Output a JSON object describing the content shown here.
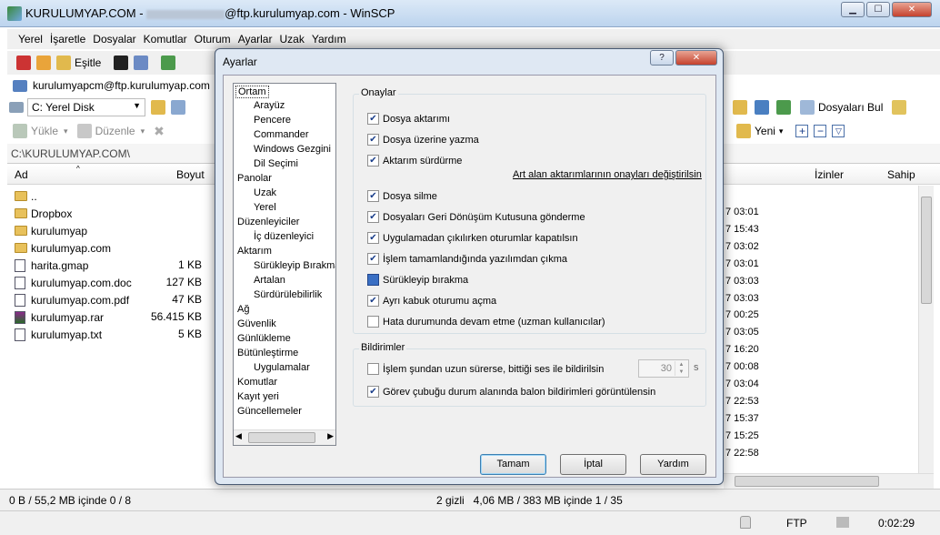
{
  "window": {
    "title_prefix": "KURULUMYAP.COM - ",
    "title_suffix": "@ftp.kurulumyap.com - WinSCP"
  },
  "menu": [
    "Yerel",
    "İşaretle",
    "Dosyalar",
    "Komutlar",
    "Oturum",
    "Ayarlar",
    "Uzak",
    "Yardım"
  ],
  "toolbar": {
    "sync_label": "Eşitle"
  },
  "session": {
    "label": "kurulumyapcm@ftp.kurulumyap.com"
  },
  "local": {
    "drive": "C: Yerel Disk",
    "upload": "Yükle",
    "edit": "Düzenle",
    "path": "C:\\KURULUMYAP.COM\\",
    "col_name": "Ad",
    "col_size": "Boyut",
    "files": [
      {
        "name": "..",
        "size": "",
        "icon": "folder-up"
      },
      {
        "name": "Dropbox",
        "size": "",
        "icon": "folder"
      },
      {
        "name": "kurulumyap",
        "size": "",
        "icon": "folder"
      },
      {
        "name": "kurulumyap.com",
        "size": "",
        "icon": "folder"
      },
      {
        "name": "harita.gmap",
        "size": "1 KB",
        "icon": "doc"
      },
      {
        "name": "kurulumyap.com.doc",
        "size": "127 KB",
        "icon": "doc"
      },
      {
        "name": "kurulumyap.com.pdf",
        "size": "47 KB",
        "icon": "doc"
      },
      {
        "name": "kurulumyap.rar",
        "size": "56.415 KB",
        "icon": "rar"
      },
      {
        "name": "kurulumyap.txt",
        "size": "5 KB",
        "icon": "doc"
      }
    ],
    "status": "0 B / 55,2 MB içinde 0 / 8"
  },
  "remote": {
    "find": "Dosyaları Bul",
    "new": "Yeni",
    "col_perm": "İzinler",
    "col_owner": "Sahip",
    "times": [
      "7 03:01",
      "7 15:43",
      "7 03:02",
      "7 03:01",
      "7 03:03",
      "7 03:03",
      "7 00:25",
      "7 03:05",
      "7 16:20",
      "7 00:08",
      "7 03:04",
      "7 22:53",
      "7 15:37",
      "7 15:25",
      "7 22:58"
    ],
    "status": "2 gizli   4,06 MB / 383 MB içinde 1 / 35"
  },
  "bottom": {
    "protocol": "FTP",
    "time": "0:02:29"
  },
  "dialog": {
    "title": "Ayarlar",
    "tree": [
      "Ortam",
      "Arayüz",
      "Pencere",
      "Commander",
      "Windows Gezgini",
      "Dil Seçimi",
      "Panolar",
      "Uzak",
      "Yerel",
      "Düzenleyiciler",
      "İç düzenleyici",
      "Aktarım",
      "Sürükleyip Bırakma",
      "Artalan",
      "Sürdürülebilirlik",
      "Ağ",
      "Güvenlik",
      "Günlükleme",
      "Bütünleştirme",
      "Uygulamalar",
      "Komutlar",
      "Kayıt yeri",
      "Güncellemeler"
    ],
    "confirm_group": "Onaylar",
    "confirms": [
      "Dosya aktarımı",
      "Dosya üzerine yazma",
      "Aktarım sürdürme",
      "Dosya silme",
      "Dosyaları Geri Dönüşüm Kutusuna gönderme",
      "Uygulamadan çıkılırken oturumlar kapatılsın",
      "İşlem tamamlandığında yazılımdan çıkma",
      "Sürükleyip bırakma",
      "Ayrı kabuk oturumu açma",
      "Hata durumunda devam etme (uzman kullanıcılar)"
    ],
    "bg_link": "Art alan aktarımlarının onayları değiştirilsin",
    "notify_group": "Bildirimler",
    "notify1": "İşlem şundan uzun sürerse, bittiği ses ile bildirilsin",
    "notify1_value": "30",
    "notify1_unit": "s",
    "notify2": "Görev çubuğu durum alanında balon bildirimleri görüntülensin",
    "ok": "Tamam",
    "cancel": "İptal",
    "help": "Yardım"
  }
}
